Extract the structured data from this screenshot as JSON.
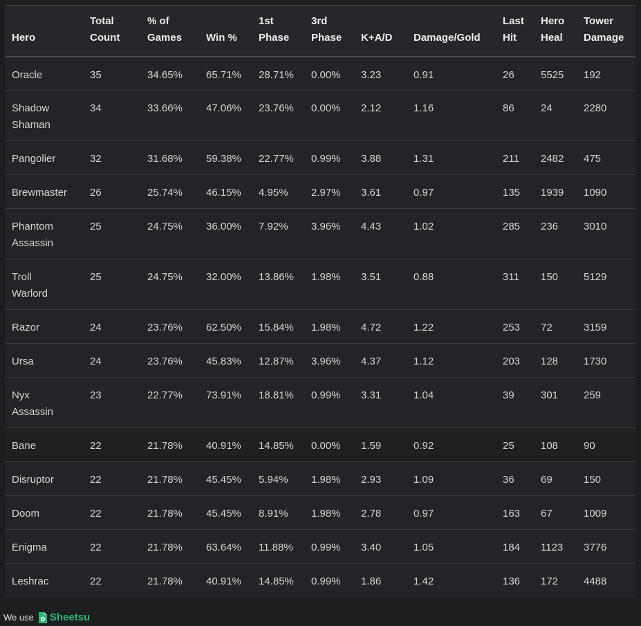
{
  "table": {
    "headers": [
      [
        "Hero"
      ],
      [
        "Total",
        "Count"
      ],
      [
        "% of",
        "Games"
      ],
      [
        "Win %"
      ],
      [
        "1st",
        "Phase"
      ],
      [
        "3rd",
        "Phase"
      ],
      [
        "K+A/D"
      ],
      [
        "Damage/Gold"
      ],
      [
        "Last",
        "Hit"
      ],
      [
        "Hero",
        "Heal"
      ],
      [
        "Tower",
        "Damage"
      ]
    ],
    "rows": [
      {
        "hero": [
          "Oracle"
        ],
        "total": "35",
        "pct": "34.65%",
        "win": "65.71%",
        "first": "28.71%",
        "third": "0.00%",
        "kad": "3.23",
        "dmg_gold": "0.91",
        "last_hit": "26",
        "heal": "5525",
        "tower": "192"
      },
      {
        "hero": [
          "Shadow",
          "Shaman"
        ],
        "total": "34",
        "pct": "33.66%",
        "win": "47.06%",
        "first": "23.76%",
        "third": "0.00%",
        "kad": "2.12",
        "dmg_gold": "1.16",
        "last_hit": "86",
        "heal": "24",
        "tower": "2280"
      },
      {
        "hero": [
          "Pangolier"
        ],
        "total": "32",
        "pct": "31.68%",
        "win": "59.38%",
        "first": "22.77%",
        "third": "0.99%",
        "kad": "3.88",
        "dmg_gold": "1.31",
        "last_hit": "211",
        "heal": "2482",
        "tower": "475"
      },
      {
        "hero": [
          "Brewmaster"
        ],
        "total": "26",
        "pct": "25.74%",
        "win": "46.15%",
        "first": "4.95%",
        "third": "2.97%",
        "kad": "3.61",
        "dmg_gold": "0.97",
        "last_hit": "135",
        "heal": "1939",
        "tower": "1090"
      },
      {
        "hero": [
          "Phantom",
          "Assassin"
        ],
        "total": "25",
        "pct": "24.75%",
        "win": "36.00%",
        "first": "7.92%",
        "third": "3.96%",
        "kad": "4.43",
        "dmg_gold": "1.02",
        "last_hit": "285",
        "heal": "236",
        "tower": "3010"
      },
      {
        "hero": [
          "Troll",
          "Warlord"
        ],
        "total": "25",
        "pct": "24.75%",
        "win": "32.00%",
        "first": "13.86%",
        "third": "1.98%",
        "kad": "3.51",
        "dmg_gold": "0.88",
        "last_hit": "311",
        "heal": "150",
        "tower": "5129"
      },
      {
        "hero": [
          "Razor"
        ],
        "total": "24",
        "pct": "23.76%",
        "win": "62.50%",
        "first": "15.84%",
        "third": "1.98%",
        "kad": "4.72",
        "dmg_gold": "1.22",
        "last_hit": "253",
        "heal": "72",
        "tower": "3159"
      },
      {
        "hero": [
          "Ursa"
        ],
        "total": "24",
        "pct": "23.76%",
        "win": "45.83%",
        "first": "12.87%",
        "third": "3.96%",
        "kad": "4.37",
        "dmg_gold": "1.12",
        "last_hit": "203",
        "heal": "128",
        "tower": "1730"
      },
      {
        "hero": [
          "Nyx",
          "Assassin"
        ],
        "total": "23",
        "pct": "22.77%",
        "win": "73.91%",
        "first": "18.81%",
        "third": "0.99%",
        "kad": "3.31",
        "dmg_gold": "1.04",
        "last_hit": "39",
        "heal": "301",
        "tower": "259"
      },
      {
        "hero": [
          "Bane"
        ],
        "total": "22",
        "pct": "21.78%",
        "win": "40.91%",
        "first": "14.85%",
        "third": "0.00%",
        "kad": "1.59",
        "dmg_gold": "0.92",
        "last_hit": "25",
        "heal": "108",
        "tower": "90"
      },
      {
        "hero": [
          "Disruptor"
        ],
        "total": "22",
        "pct": "21.78%",
        "win": "45.45%",
        "first": "5.94%",
        "third": "1.98%",
        "kad": "2.93",
        "dmg_gold": "1.09",
        "last_hit": "36",
        "heal": "69",
        "tower": "150"
      },
      {
        "hero": [
          "Doom"
        ],
        "total": "22",
        "pct": "21.78%",
        "win": "45.45%",
        "first": "8.91%",
        "third": "1.98%",
        "kad": "2.78",
        "dmg_gold": "0.97",
        "last_hit": "163",
        "heal": "67",
        "tower": "1009"
      },
      {
        "hero": [
          "Enigma"
        ],
        "total": "22",
        "pct": "21.78%",
        "win": "63.64%",
        "first": "11.88%",
        "third": "0.99%",
        "kad": "3.40",
        "dmg_gold": "1.05",
        "last_hit": "184",
        "heal": "1123",
        "tower": "3776"
      },
      {
        "hero": [
          "Leshrac"
        ],
        "total": "22",
        "pct": "21.78%",
        "win": "40.91%",
        "first": "14.85%",
        "third": "0.99%",
        "kad": "1.86",
        "dmg_gold": "1.42",
        "last_hit": "136",
        "heal": "172",
        "tower": "4488"
      }
    ]
  },
  "footer": {
    "prefix": "We use",
    "brand": "Sheetsu",
    "brand_icon": "sheetsu-gear-icon",
    "brand_color": "#2bb673"
  },
  "colors": {
    "background": "#1d1e20",
    "table_background": "#232427",
    "text": "#d6d6d6"
  }
}
